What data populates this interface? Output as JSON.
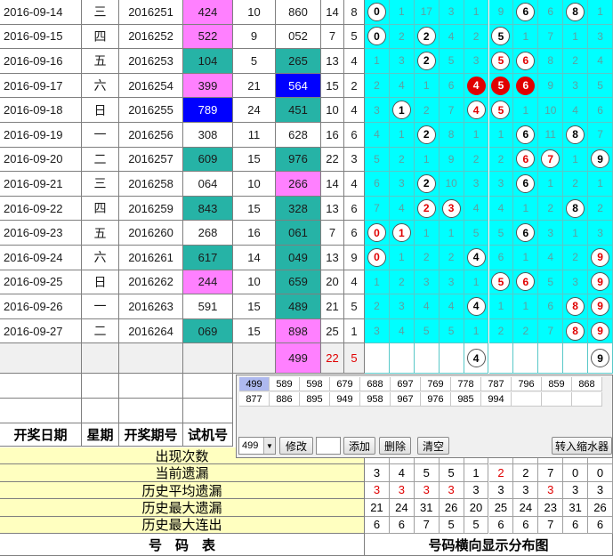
{
  "rows": [
    {
      "date": "2016-09-14",
      "week": "三",
      "issue": "2016251",
      "trial": "424",
      "trial_color": "magenta",
      "span1": "10",
      "draw": "860",
      "draw_color": "white",
      "sum": "14",
      "span2": "8"
    },
    {
      "date": "2016-09-15",
      "week": "四",
      "issue": "2016252",
      "trial": "522",
      "trial_color": "magenta",
      "span1": "9",
      "draw": "052",
      "draw_color": "white",
      "sum": "7",
      "span2": "5"
    },
    {
      "date": "2016-09-16",
      "week": "五",
      "issue": "2016253",
      "trial": "104",
      "trial_color": "teal",
      "span1": "5",
      "draw": "265",
      "draw_color": "teal",
      "sum": "13",
      "span2": "4"
    },
    {
      "date": "2016-09-17",
      "week": "六",
      "issue": "2016254",
      "trial": "399",
      "trial_color": "magenta",
      "span1": "21",
      "draw": "564",
      "draw_color": "blue",
      "sum": "15",
      "span2": "2"
    },
    {
      "date": "2016-09-18",
      "week": "日",
      "issue": "2016255",
      "trial": "789",
      "trial_color": "blue",
      "span1": "24",
      "draw": "451",
      "draw_color": "teal",
      "sum": "10",
      "span2": "4"
    },
    {
      "date": "2016-09-19",
      "week": "一",
      "issue": "2016256",
      "trial": "308",
      "trial_color": "white",
      "span1": "11",
      "draw": "628",
      "draw_color": "white",
      "sum": "16",
      "span2": "6"
    },
    {
      "date": "2016-09-20",
      "week": "二",
      "issue": "2016257",
      "trial": "609",
      "trial_color": "teal",
      "span1": "15",
      "draw": "976",
      "draw_color": "teal",
      "sum": "22",
      "span2": "3"
    },
    {
      "date": "2016-09-21",
      "week": "三",
      "issue": "2016258",
      "trial": "064",
      "trial_color": "white",
      "span1": "10",
      "draw": "266",
      "draw_color": "magenta",
      "sum": "14",
      "span2": "4"
    },
    {
      "date": "2016-09-22",
      "week": "四",
      "issue": "2016259",
      "trial": "843",
      "trial_color": "teal",
      "span1": "15",
      "draw": "328",
      "draw_color": "teal",
      "sum": "13",
      "span2": "6"
    },
    {
      "date": "2016-09-23",
      "week": "五",
      "issue": "2016260",
      "trial": "268",
      "trial_color": "white",
      "span1": "16",
      "draw": "061",
      "draw_color": "teal",
      "sum": "7",
      "span2": "6"
    },
    {
      "date": "2016-09-24",
      "week": "六",
      "issue": "2016261",
      "trial": "617",
      "trial_color": "teal",
      "span1": "14",
      "draw": "049",
      "draw_color": "teal",
      "sum": "13",
      "span2": "9"
    },
    {
      "date": "2016-09-25",
      "week": "日",
      "issue": "2016262",
      "trial": "244",
      "trial_color": "magenta",
      "span1": "10",
      "draw": "659",
      "draw_color": "teal",
      "sum": "20",
      "span2": "4"
    },
    {
      "date": "2016-09-26",
      "week": "一",
      "issue": "2016263",
      "trial": "591",
      "trial_color": "white",
      "span1": "15",
      "draw": "489",
      "draw_color": "teal",
      "sum": "21",
      "span2": "5"
    },
    {
      "date": "2016-09-27",
      "week": "二",
      "issue": "2016264",
      "trial": "069",
      "trial_color": "teal",
      "span1": "15",
      "draw": "898",
      "draw_color": "magenta",
      "sum": "25",
      "span2": "1"
    }
  ],
  "dist": [
    [
      [
        "0",
        "ball"
      ],
      [
        "1",
        ""
      ],
      [
        "17",
        ""
      ],
      [
        "3",
        ""
      ],
      [
        "1",
        ""
      ],
      [
        "9",
        ""
      ],
      [
        "6",
        "ball"
      ],
      [
        "6",
        ""
      ],
      [
        "8",
        "ball"
      ],
      [
        "1",
        ""
      ]
    ],
    [
      [
        "0",
        "ball"
      ],
      [
        "2",
        ""
      ],
      [
        "2",
        "ball"
      ],
      [
        "4",
        ""
      ],
      [
        "2",
        ""
      ],
      [
        "5",
        "ball"
      ],
      [
        "1",
        ""
      ],
      [
        "7",
        ""
      ],
      [
        "1",
        ""
      ],
      [
        "3",
        ""
      ]
    ],
    [
      [
        "1",
        ""
      ],
      [
        "3",
        ""
      ],
      [
        "2",
        "ball"
      ],
      [
        "5",
        ""
      ],
      [
        "3",
        ""
      ],
      [
        "5",
        "ball red"
      ],
      [
        "6",
        "ball red"
      ],
      [
        "8",
        ""
      ],
      [
        "2",
        ""
      ],
      [
        "4",
        ""
      ]
    ],
    [
      [
        "2",
        ""
      ],
      [
        "4",
        ""
      ],
      [
        "1",
        ""
      ],
      [
        "6",
        ""
      ],
      [
        "4",
        "ball solid"
      ],
      [
        "5",
        "ball solid"
      ],
      [
        "6",
        "ball solid"
      ],
      [
        "9",
        ""
      ],
      [
        "3",
        ""
      ],
      [
        "5",
        ""
      ]
    ],
    [
      [
        "3",
        ""
      ],
      [
        "1",
        "ball"
      ],
      [
        "2",
        ""
      ],
      [
        "7",
        ""
      ],
      [
        "4",
        "ball red"
      ],
      [
        "5",
        "ball red"
      ],
      [
        "1",
        ""
      ],
      [
        "10",
        ""
      ],
      [
        "4",
        ""
      ],
      [
        "6",
        ""
      ]
    ],
    [
      [
        "4",
        ""
      ],
      [
        "1",
        ""
      ],
      [
        "2",
        "ball"
      ],
      [
        "8",
        ""
      ],
      [
        "1",
        ""
      ],
      [
        "1",
        ""
      ],
      [
        "6",
        "ball"
      ],
      [
        "11",
        ""
      ],
      [
        "8",
        "ball"
      ],
      [
        "7",
        ""
      ]
    ],
    [
      [
        "5",
        ""
      ],
      [
        "2",
        ""
      ],
      [
        "1",
        ""
      ],
      [
        "9",
        ""
      ],
      [
        "2",
        ""
      ],
      [
        "2",
        ""
      ],
      [
        "6",
        "ball red"
      ],
      [
        "7",
        "ball red"
      ],
      [
        "1",
        ""
      ],
      [
        "9",
        "ball"
      ]
    ],
    [
      [
        "6",
        ""
      ],
      [
        "3",
        ""
      ],
      [
        "2",
        "ball"
      ],
      [
        "10",
        ""
      ],
      [
        "3",
        ""
      ],
      [
        "3",
        ""
      ],
      [
        "6",
        "ball"
      ],
      [
        "1",
        ""
      ],
      [
        "2",
        ""
      ],
      [
        "1",
        ""
      ]
    ],
    [
      [
        "7",
        ""
      ],
      [
        "4",
        ""
      ],
      [
        "2",
        "ball red"
      ],
      [
        "3",
        "ball red"
      ],
      [
        "4",
        ""
      ],
      [
        "4",
        ""
      ],
      [
        "1",
        ""
      ],
      [
        "2",
        ""
      ],
      [
        "8",
        "ball"
      ],
      [
        "2",
        ""
      ]
    ],
    [
      [
        "0",
        "ball red"
      ],
      [
        "1",
        "ball red"
      ],
      [
        "1",
        ""
      ],
      [
        "1",
        ""
      ],
      [
        "5",
        ""
      ],
      [
        "5",
        ""
      ],
      [
        "6",
        "ball"
      ],
      [
        "3",
        ""
      ],
      [
        "1",
        ""
      ],
      [
        "3",
        ""
      ]
    ],
    [
      [
        "0",
        "ball red"
      ],
      [
        "1",
        ""
      ],
      [
        "2",
        ""
      ],
      [
        "2",
        ""
      ],
      [
        "4",
        "ball"
      ],
      [
        "6",
        ""
      ],
      [
        "1",
        ""
      ],
      [
        "4",
        ""
      ],
      [
        "2",
        ""
      ],
      [
        "9",
        "ball red"
      ]
    ],
    [
      [
        "1",
        ""
      ],
      [
        "2",
        ""
      ],
      [
        "3",
        ""
      ],
      [
        "3",
        ""
      ],
      [
        "1",
        ""
      ],
      [
        "5",
        "ball red"
      ],
      [
        "6",
        "ball red"
      ],
      [
        "5",
        ""
      ],
      [
        "3",
        ""
      ],
      [
        "9",
        "ball red"
      ]
    ],
    [
      [
        "2",
        ""
      ],
      [
        "3",
        ""
      ],
      [
        "4",
        ""
      ],
      [
        "4",
        ""
      ],
      [
        "4",
        "ball"
      ],
      [
        "1",
        ""
      ],
      [
        "1",
        ""
      ],
      [
        "6",
        ""
      ],
      [
        "8",
        "ball red"
      ],
      [
        "9",
        "ball red"
      ]
    ],
    [
      [
        "3",
        ""
      ],
      [
        "4",
        ""
      ],
      [
        "5",
        ""
      ],
      [
        "5",
        ""
      ],
      [
        "1",
        ""
      ],
      [
        "2",
        ""
      ],
      [
        "2",
        ""
      ],
      [
        "7",
        ""
      ],
      [
        "8",
        "ball red"
      ],
      [
        "9",
        "ball red"
      ]
    ]
  ],
  "pending": {
    "draw": "499",
    "sum": "22",
    "span": "5",
    "balls": [
      [
        "4",
        4
      ],
      [
        "9",
        9
      ]
    ]
  },
  "headers": {
    "date": "开奖日期",
    "week": "星期",
    "issue": "开奖期号",
    "trial": "试机号"
  },
  "stats": [
    {
      "label": "出现次数",
      "values": [
        "",
        "",
        "",
        "",
        "",
        "",
        "",
        "",
        "",
        ""
      ]
    },
    {
      "label": "当前遗漏",
      "values": [
        "3",
        "4",
        "5",
        "5",
        "1",
        "2",
        "2",
        "7",
        "0",
        "0"
      ]
    },
    {
      "label": "历史平均遗漏",
      "values": [
        "3",
        "3",
        "3",
        "3",
        "3",
        "3",
        "3",
        "3",
        "3",
        "3"
      ]
    },
    {
      "label": "历史最大遗漏",
      "values": [
        "21",
        "24",
        "31",
        "26",
        "20",
        "25",
        "24",
        "23",
        "31",
        "26"
      ]
    },
    {
      "label": "历史最大连出",
      "values": [
        "6",
        "6",
        "7",
        "5",
        "5",
        "6",
        "6",
        "7",
        "6",
        "6"
      ]
    }
  ],
  "footer": {
    "left": "号　码　表",
    "right": "号码横向显示分布图"
  },
  "panel": {
    "row1": [
      "499",
      "589",
      "598",
      "679",
      "688",
      "697",
      "769",
      "778",
      "787",
      "796",
      "859",
      "868"
    ],
    "row2": [
      "877",
      "886",
      "895",
      "949",
      "958",
      "967",
      "976",
      "985",
      "994",
      "",
      "",
      ""
    ],
    "combo_value": "499",
    "modify_label": "修改",
    "add_label": "添加",
    "delete_label": "删除",
    "clear_label": "清空",
    "shrink_label": "转入缩水器"
  },
  "colors": {
    "magenta": "#ff80ff",
    "teal": "#26b3a6",
    "blue": "#0000ff",
    "cyan": "#00ffff",
    "yellow": "#ffffc0",
    "red": "#e00000"
  }
}
